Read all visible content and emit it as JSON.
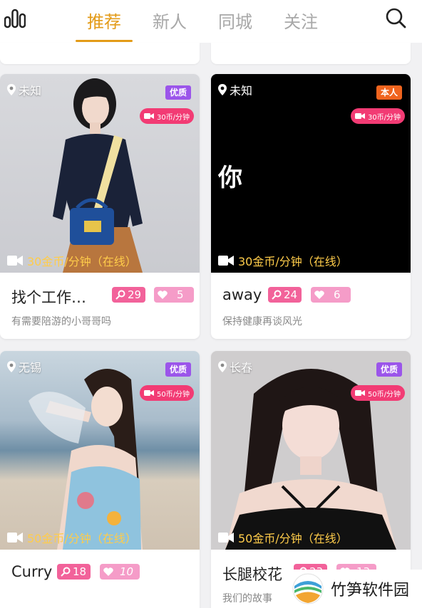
{
  "header": {
    "tabs": [
      {
        "label": "推荐",
        "active": true
      },
      {
        "label": "新人",
        "active": false
      },
      {
        "label": "同城",
        "active": false
      },
      {
        "label": "关注",
        "active": false
      }
    ]
  },
  "colors": {
    "accent": "#e39b18",
    "badge_quality": "#9b55ea",
    "badge_self": "#f0641e",
    "pill": "#f23b74",
    "key_stat": "#f2629a",
    "heart_stat": "#f59cc8",
    "price_text": "#ffcc4a"
  },
  "cards": [
    {
      "location": "未知",
      "badge": "优质",
      "pill": "30币/分钟",
      "price": "30金币/分钟（在线）",
      "name": "找个工作…",
      "keys": "29",
      "hearts": "5",
      "desc": "有需要陪游的小哥哥吗"
    },
    {
      "location": "未知",
      "badge": "本人",
      "pill": "30币/分钟",
      "price": "30金币/分钟（在线）",
      "name": "away",
      "keys": "24",
      "hearts": "6",
      "desc": "保持健康再谈风光",
      "photo_text": "你"
    },
    {
      "location": "无锡",
      "badge": "优质",
      "pill": "50币/分钟",
      "price": "50金币/分钟（在线）",
      "name": "Curry",
      "keys": "18",
      "hearts": "10",
      "desc": ""
    },
    {
      "location": "长春",
      "badge": "优质",
      "pill": "50币/分钟",
      "price": "50金币/分钟（在线）",
      "name": "长腿校花",
      "keys": "23",
      "hearts": "13",
      "desc": "我们的故事"
    }
  ],
  "watermark": {
    "text": "竹笋软件园"
  }
}
